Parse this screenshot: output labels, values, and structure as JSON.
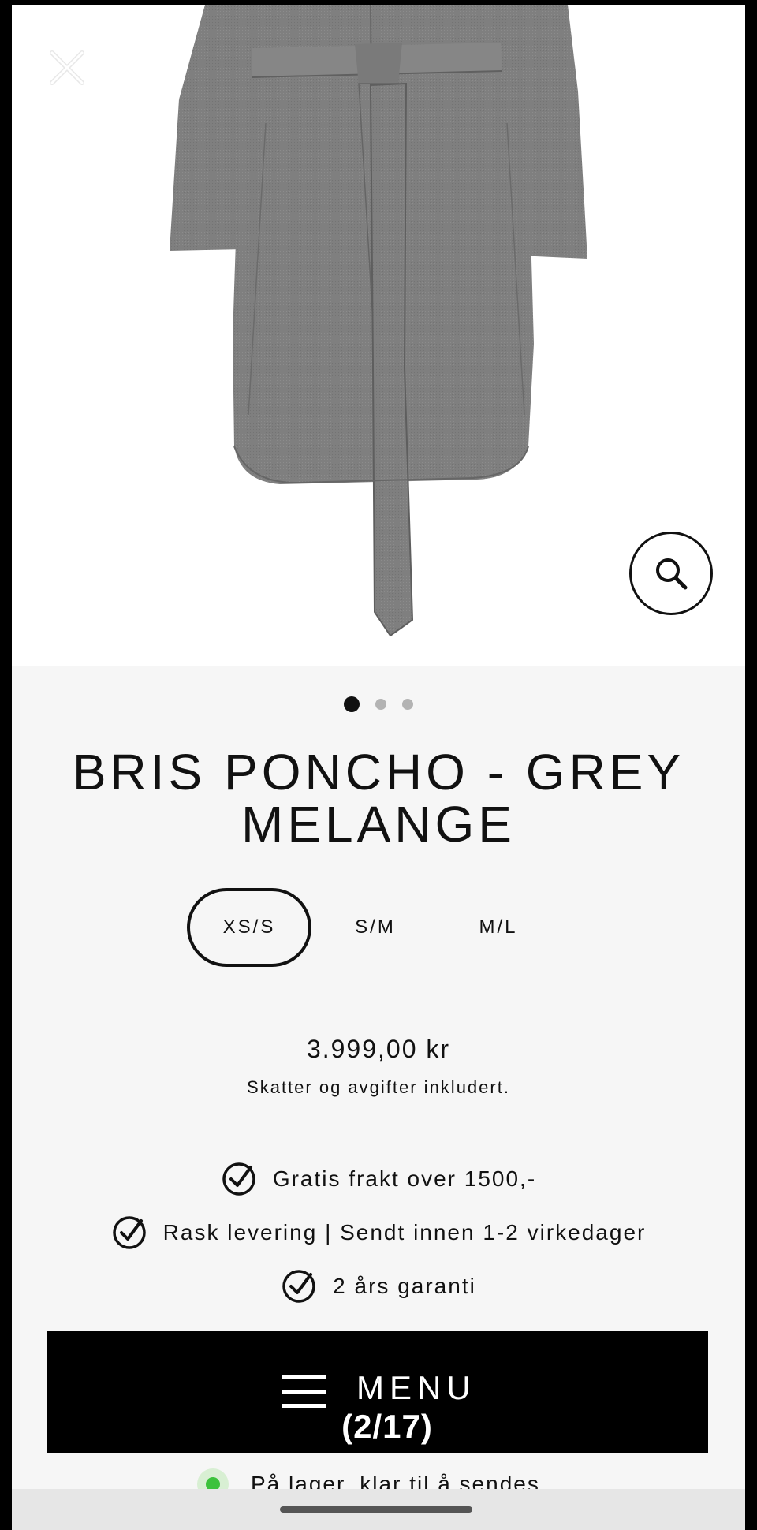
{
  "image_gallery": {
    "dots": [
      {
        "active": true
      },
      {
        "active": false
      },
      {
        "active": false
      }
    ]
  },
  "product": {
    "title_line1": "BRIS PONCHO - GREY",
    "title_line2": "MELANGE",
    "sizes": [
      {
        "label": "XS/S",
        "selected": true
      },
      {
        "label": "S/M",
        "selected": false
      },
      {
        "label": "M/L",
        "selected": false
      }
    ],
    "price": "3.999,00 kr",
    "tax_note": "Skatter og avgifter inkludert.",
    "features": [
      {
        "icon": "check-circle-icon",
        "text": "Gratis frakt over 1500,-"
      },
      {
        "icon": "check-circle-icon",
        "text": "Rask levering | Sendt innen 1-2 virkedager"
      },
      {
        "icon": "check-circle-icon",
        "text": "2 års garanti"
      }
    ],
    "stock": {
      "text": "På lager, klar til å sendes",
      "color": "#3cc23c"
    }
  },
  "menu_bar": {
    "label": "MENU",
    "count": "(2/17)",
    "icon": "hamburger-icon"
  },
  "icons": {
    "close": "close-icon",
    "zoom": "search-icon"
  },
  "colors": {
    "background": "#f6f6f6",
    "accent": "#000000",
    "coat": "#808080"
  }
}
